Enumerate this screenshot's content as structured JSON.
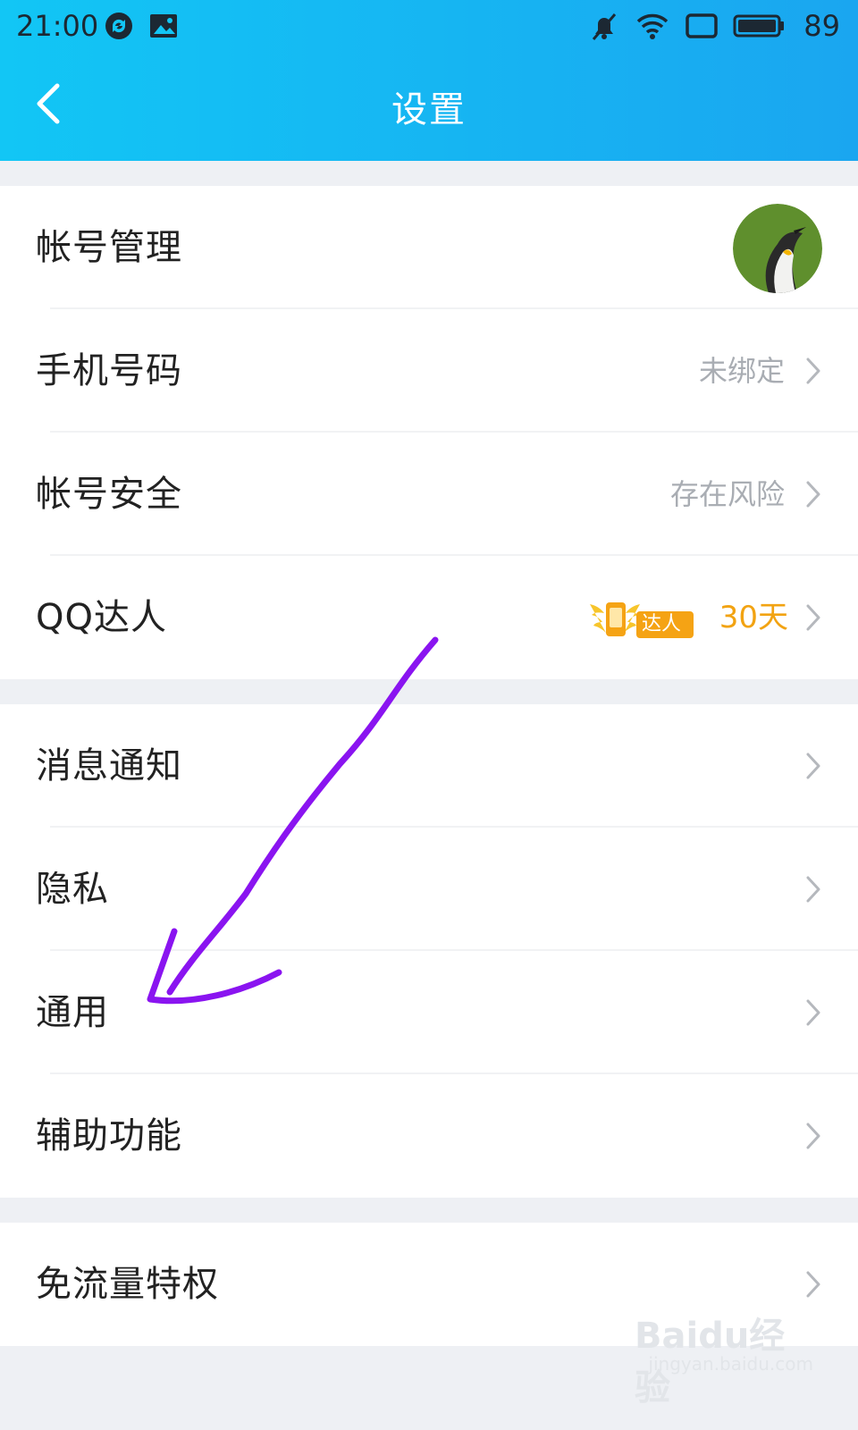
{
  "status_bar": {
    "time": "21:00",
    "battery_level": "89",
    "icons": [
      "sync-icon",
      "image-icon",
      "mute-icon",
      "wifi-icon",
      "screen-icon",
      "battery-icon"
    ]
  },
  "header": {
    "title": "设置",
    "back_icon": "back-chevron-icon",
    "gradient_colors": [
      "#12c6f5",
      "#1aa6f0"
    ]
  },
  "account_section": {
    "items": [
      {
        "label": "帐号管理",
        "trailing": "avatar"
      },
      {
        "label": "手机号码",
        "value": "未绑定"
      },
      {
        "label": "帐号安全",
        "value": "存在风险"
      },
      {
        "label": "QQ达人",
        "badge_text": "达人",
        "value": "30天"
      }
    ]
  },
  "general_section": {
    "items": [
      {
        "label": "消息通知"
      },
      {
        "label": "隐私"
      },
      {
        "label": "通用"
      },
      {
        "label": "辅助功能"
      }
    ]
  },
  "extra_section": {
    "items": [
      {
        "label": "免流量特权"
      }
    ]
  },
  "annotation": {
    "type": "hand-drawn-arrow",
    "color": "#8a14f0",
    "points_to": "通用"
  },
  "watermark": {
    "main": "Baidu经验",
    "sub": "jingyan.baidu.com"
  },
  "colors": {
    "accent_value": "#f2a312",
    "secondary_text": "#a9adb3",
    "primary_text": "#222222",
    "background": "#eef0f4"
  }
}
